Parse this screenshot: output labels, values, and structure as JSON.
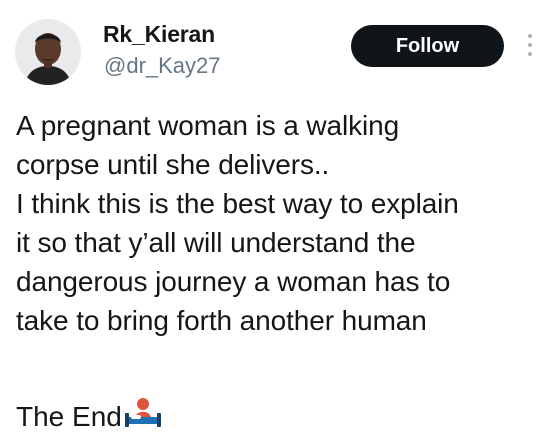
{
  "author": {
    "display_name": "Rk_Kieran",
    "handle": "@dr_Kay27",
    "avatar_icon": "profile-photo"
  },
  "actions": {
    "follow_label": "Follow",
    "more_icon": "vertical-ellipsis-icon"
  },
  "tweet": {
    "lines": [
      "A pregnant woman is a walking",
      "corpse until she delivers..",
      "I think this is the best way to explain",
      "it so that y’all will understand the",
      "dangerous journey a woman has to",
      "take to bring forth another human"
    ],
    "ending": "The End",
    "ending_emoji": "person-in-bed-emoji"
  },
  "colors": {
    "text": "#14171a",
    "handle": "#657786",
    "follow_bg": "#0f1419",
    "follow_text": "#ffffff"
  }
}
